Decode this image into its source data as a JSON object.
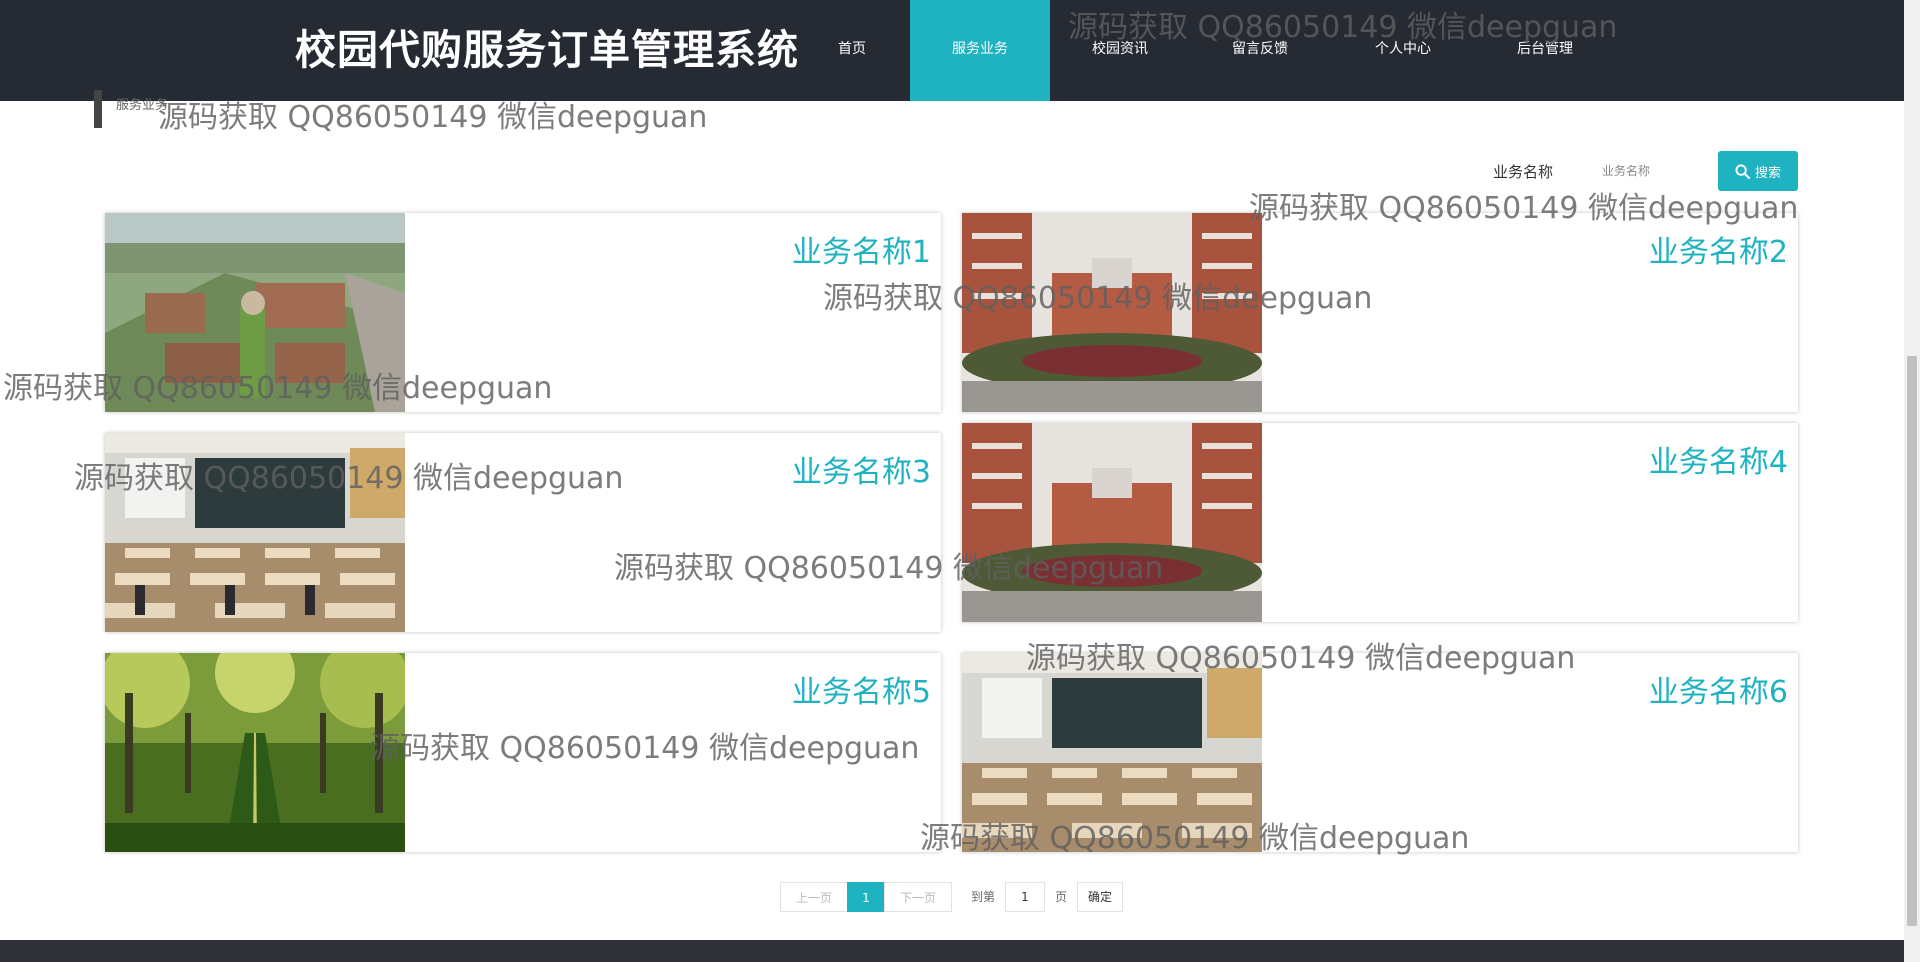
{
  "header": {
    "site_title": "校园代购服务订单管理系统",
    "nav": [
      {
        "label": "首页"
      },
      {
        "label": "服务业务"
      },
      {
        "label": "校园资讯"
      },
      {
        "label": "留言反馈"
      },
      {
        "label": "个人中心"
      },
      {
        "label": "后台管理"
      }
    ],
    "active_nav": "服务业务"
  },
  "breadcrumb": {
    "text": "服务业务"
  },
  "search": {
    "label": "业务名称",
    "placeholder": "业务名称",
    "button_label": "搜索",
    "button_icon": "search-icon"
  },
  "cards": [
    {
      "title": "业务名称1",
      "image": "campus-aerial-view"
    },
    {
      "title": "业务名称2",
      "image": "school-building-front"
    },
    {
      "title": "业务名称3",
      "image": "classroom"
    },
    {
      "title": "业务名称4",
      "image": "school-building-front"
    },
    {
      "title": "业务名称5",
      "image": "tree-lined-path"
    },
    {
      "title": "业务名称6",
      "image": "classroom"
    }
  ],
  "pagination": {
    "prev_label": "上一页",
    "current_page": "1",
    "next_label": "下一页",
    "goto_label": "到第",
    "page_input_value": "1",
    "page_suffix": "页",
    "confirm_label": "确定"
  },
  "watermark": {
    "text": "源码获取 QQ86050149 微信deepguan"
  },
  "colors": {
    "accent": "#1fb2c1",
    "header_bg": "#252a33",
    "footer_bg": "#2f3137"
  }
}
